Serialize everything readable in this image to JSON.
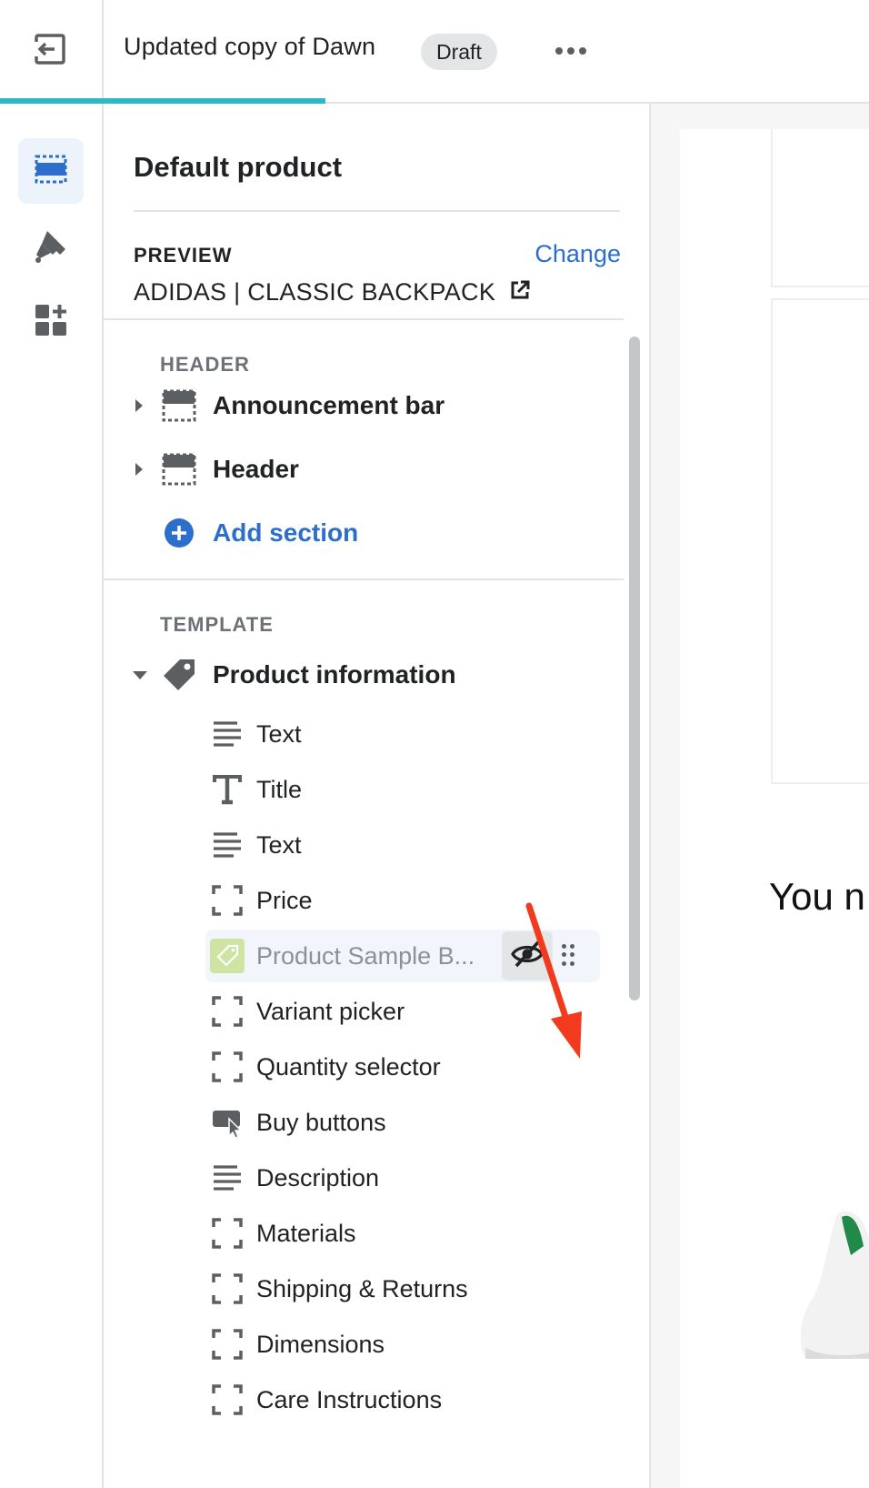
{
  "topbar": {
    "theme_name": "Updated copy of Dawn",
    "status_badge": "Draft"
  },
  "sidebar": {
    "title": "Default product",
    "preview_label": "PREVIEW",
    "change_label": "Change",
    "preview_product": "ADIDAS | CLASSIC BACKPACK",
    "header_group": {
      "label": "HEADER",
      "sections": [
        {
          "label": "Announcement bar"
        },
        {
          "label": "Header"
        }
      ],
      "add_section": "Add section"
    },
    "template_group": {
      "label": "TEMPLATE",
      "section": "Product information",
      "blocks": [
        {
          "label": "Text",
          "icon": "text-lines-icon"
        },
        {
          "label": "Title",
          "icon": "title-t-icon"
        },
        {
          "label": "Text",
          "icon": "text-lines-icon"
        },
        {
          "label": "Price",
          "icon": "placeholder-frame-icon"
        },
        {
          "label": "Product Sample B...",
          "icon": "app-tag-icon",
          "hidden": true
        },
        {
          "label": "Variant picker",
          "icon": "placeholder-frame-icon"
        },
        {
          "label": "Quantity selector",
          "icon": "placeholder-frame-icon"
        },
        {
          "label": "Buy buttons",
          "icon": "buy-button-cursor-icon"
        },
        {
          "label": "Description",
          "icon": "text-lines-icon"
        },
        {
          "label": "Materials",
          "icon": "placeholder-frame-icon"
        },
        {
          "label": "Shipping & Returns",
          "icon": "placeholder-frame-icon"
        },
        {
          "label": "Dimensions",
          "icon": "placeholder-frame-icon"
        },
        {
          "label": "Care Instructions",
          "icon": "placeholder-frame-icon"
        }
      ]
    }
  },
  "canvas": {
    "partial_text": "You n"
  },
  "colors": {
    "accent": "#2c6ecb",
    "progress": "#2bb8c7",
    "annotation_arrow": "#f23a1e"
  }
}
